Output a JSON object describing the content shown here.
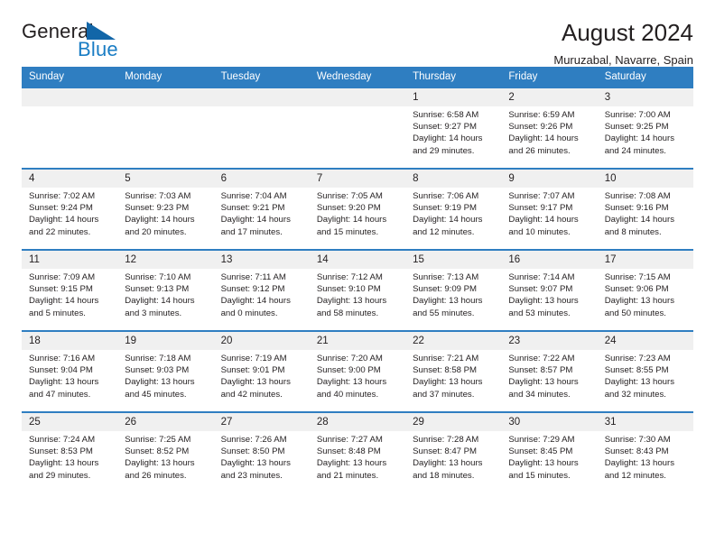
{
  "brand": {
    "word_one": "General",
    "word_two": "Blue",
    "accent_color": "#1266a8",
    "blue_text_color": "#1a7dc4"
  },
  "header": {
    "title": "August 2024",
    "subtitle": "Muruzabal, Navarre, Spain",
    "header_bg": "#2f7ec1",
    "daynum_bg": "#f0f0f0"
  },
  "weekdays": [
    "Sunday",
    "Monday",
    "Tuesday",
    "Wednesday",
    "Thursday",
    "Friday",
    "Saturday"
  ],
  "labels": {
    "sunrise_prefix": "Sunrise:",
    "sunset_prefix": "Sunset:",
    "daylight_prefix": "Daylight:"
  },
  "weeks": [
    [
      {
        "day": "",
        "line1": "",
        "line2": "",
        "line3": "",
        "line4": ""
      },
      {
        "day": "",
        "line1": "",
        "line2": "",
        "line3": "",
        "line4": ""
      },
      {
        "day": "",
        "line1": "",
        "line2": "",
        "line3": "",
        "line4": ""
      },
      {
        "day": "",
        "line1": "",
        "line2": "",
        "line3": "",
        "line4": ""
      },
      {
        "day": "1",
        "line1": "Sunrise: 6:58 AM",
        "line2": "Sunset: 9:27 PM",
        "line3": "Daylight: 14 hours",
        "line4": "and 29 minutes."
      },
      {
        "day": "2",
        "line1": "Sunrise: 6:59 AM",
        "line2": "Sunset: 9:26 PM",
        "line3": "Daylight: 14 hours",
        "line4": "and 26 minutes."
      },
      {
        "day": "3",
        "line1": "Sunrise: 7:00 AM",
        "line2": "Sunset: 9:25 PM",
        "line3": "Daylight: 14 hours",
        "line4": "and 24 minutes."
      }
    ],
    [
      {
        "day": "4",
        "line1": "Sunrise: 7:02 AM",
        "line2": "Sunset: 9:24 PM",
        "line3": "Daylight: 14 hours",
        "line4": "and 22 minutes."
      },
      {
        "day": "5",
        "line1": "Sunrise: 7:03 AM",
        "line2": "Sunset: 9:23 PM",
        "line3": "Daylight: 14 hours",
        "line4": "and 20 minutes."
      },
      {
        "day": "6",
        "line1": "Sunrise: 7:04 AM",
        "line2": "Sunset: 9:21 PM",
        "line3": "Daylight: 14 hours",
        "line4": "and 17 minutes."
      },
      {
        "day": "7",
        "line1": "Sunrise: 7:05 AM",
        "line2": "Sunset: 9:20 PM",
        "line3": "Daylight: 14 hours",
        "line4": "and 15 minutes."
      },
      {
        "day": "8",
        "line1": "Sunrise: 7:06 AM",
        "line2": "Sunset: 9:19 PM",
        "line3": "Daylight: 14 hours",
        "line4": "and 12 minutes."
      },
      {
        "day": "9",
        "line1": "Sunrise: 7:07 AM",
        "line2": "Sunset: 9:17 PM",
        "line3": "Daylight: 14 hours",
        "line4": "and 10 minutes."
      },
      {
        "day": "10",
        "line1": "Sunrise: 7:08 AM",
        "line2": "Sunset: 9:16 PM",
        "line3": "Daylight: 14 hours",
        "line4": "and 8 minutes."
      }
    ],
    [
      {
        "day": "11",
        "line1": "Sunrise: 7:09 AM",
        "line2": "Sunset: 9:15 PM",
        "line3": "Daylight: 14 hours",
        "line4": "and 5 minutes."
      },
      {
        "day": "12",
        "line1": "Sunrise: 7:10 AM",
        "line2": "Sunset: 9:13 PM",
        "line3": "Daylight: 14 hours",
        "line4": "and 3 minutes."
      },
      {
        "day": "13",
        "line1": "Sunrise: 7:11 AM",
        "line2": "Sunset: 9:12 PM",
        "line3": "Daylight: 14 hours",
        "line4": "and 0 minutes."
      },
      {
        "day": "14",
        "line1": "Sunrise: 7:12 AM",
        "line2": "Sunset: 9:10 PM",
        "line3": "Daylight: 13 hours",
        "line4": "and 58 minutes."
      },
      {
        "day": "15",
        "line1": "Sunrise: 7:13 AM",
        "line2": "Sunset: 9:09 PM",
        "line3": "Daylight: 13 hours",
        "line4": "and 55 minutes."
      },
      {
        "day": "16",
        "line1": "Sunrise: 7:14 AM",
        "line2": "Sunset: 9:07 PM",
        "line3": "Daylight: 13 hours",
        "line4": "and 53 minutes."
      },
      {
        "day": "17",
        "line1": "Sunrise: 7:15 AM",
        "line2": "Sunset: 9:06 PM",
        "line3": "Daylight: 13 hours",
        "line4": "and 50 minutes."
      }
    ],
    [
      {
        "day": "18",
        "line1": "Sunrise: 7:16 AM",
        "line2": "Sunset: 9:04 PM",
        "line3": "Daylight: 13 hours",
        "line4": "and 47 minutes."
      },
      {
        "day": "19",
        "line1": "Sunrise: 7:18 AM",
        "line2": "Sunset: 9:03 PM",
        "line3": "Daylight: 13 hours",
        "line4": "and 45 minutes."
      },
      {
        "day": "20",
        "line1": "Sunrise: 7:19 AM",
        "line2": "Sunset: 9:01 PM",
        "line3": "Daylight: 13 hours",
        "line4": "and 42 minutes."
      },
      {
        "day": "21",
        "line1": "Sunrise: 7:20 AM",
        "line2": "Sunset: 9:00 PM",
        "line3": "Daylight: 13 hours",
        "line4": "and 40 minutes."
      },
      {
        "day": "22",
        "line1": "Sunrise: 7:21 AM",
        "line2": "Sunset: 8:58 PM",
        "line3": "Daylight: 13 hours",
        "line4": "and 37 minutes."
      },
      {
        "day": "23",
        "line1": "Sunrise: 7:22 AM",
        "line2": "Sunset: 8:57 PM",
        "line3": "Daylight: 13 hours",
        "line4": "and 34 minutes."
      },
      {
        "day": "24",
        "line1": "Sunrise: 7:23 AM",
        "line2": "Sunset: 8:55 PM",
        "line3": "Daylight: 13 hours",
        "line4": "and 32 minutes."
      }
    ],
    [
      {
        "day": "25",
        "line1": "Sunrise: 7:24 AM",
        "line2": "Sunset: 8:53 PM",
        "line3": "Daylight: 13 hours",
        "line4": "and 29 minutes."
      },
      {
        "day": "26",
        "line1": "Sunrise: 7:25 AM",
        "line2": "Sunset: 8:52 PM",
        "line3": "Daylight: 13 hours",
        "line4": "and 26 minutes."
      },
      {
        "day": "27",
        "line1": "Sunrise: 7:26 AM",
        "line2": "Sunset: 8:50 PM",
        "line3": "Daylight: 13 hours",
        "line4": "and 23 minutes."
      },
      {
        "day": "28",
        "line1": "Sunrise: 7:27 AM",
        "line2": "Sunset: 8:48 PM",
        "line3": "Daylight: 13 hours",
        "line4": "and 21 minutes."
      },
      {
        "day": "29",
        "line1": "Sunrise: 7:28 AM",
        "line2": "Sunset: 8:47 PM",
        "line3": "Daylight: 13 hours",
        "line4": "and 18 minutes."
      },
      {
        "day": "30",
        "line1": "Sunrise: 7:29 AM",
        "line2": "Sunset: 8:45 PM",
        "line3": "Daylight: 13 hours",
        "line4": "and 15 minutes."
      },
      {
        "day": "31",
        "line1": "Sunrise: 7:30 AM",
        "line2": "Sunset: 8:43 PM",
        "line3": "Daylight: 13 hours",
        "line4": "and 12 minutes."
      }
    ]
  ]
}
